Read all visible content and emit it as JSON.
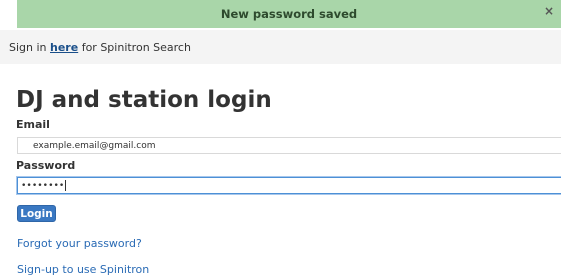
{
  "alert": {
    "message": "New password saved",
    "close_symbol": "×"
  },
  "signin_bar": {
    "prefix": "Sign in ",
    "link": "here",
    "suffix": " for Spinitron Search"
  },
  "title": "DJ and station login",
  "form": {
    "email_label": "Email",
    "email_value": "example.email@gmail.com",
    "password_label": "Password",
    "password_mask": "••••••••",
    "password_key_icon": "key-icon",
    "login_label": "Login"
  },
  "links": {
    "forgot": "Forgot your password?",
    "signup": "Sign-up to use Spinitron"
  },
  "colors": {
    "alert_bg": "#a9d6a9",
    "accent": "#3a78c2",
    "link": "#2a6bb5"
  }
}
